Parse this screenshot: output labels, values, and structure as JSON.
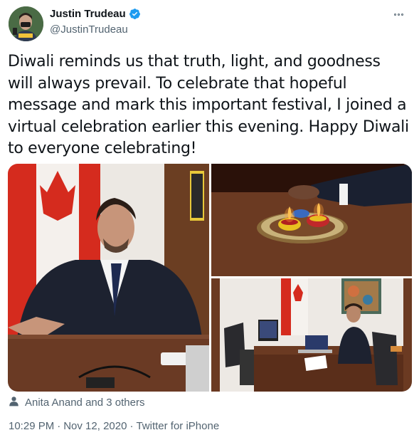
{
  "author": {
    "name": "Justin Trudeau",
    "handle": "@JustinTrudeau",
    "verified": true,
    "avatar_icon": "avatar-photo"
  },
  "tweet": {
    "text": "Diwali reminds us that truth, light, and goodness will always prevail. To celebrate that hopeful message and mark this important festival, I joined a virtual celebration earlier this evening. Happy Diwali to everyone celebrating!"
  },
  "media": [
    {
      "name": "photo-trudeau-at-desk"
    },
    {
      "name": "photo-diwali-lamps"
    },
    {
      "name": "photo-video-call-office"
    }
  ],
  "social": {
    "likes_text": "Anita Anand and 3 others",
    "icon": "person-icon"
  },
  "meta": {
    "time": "10:29 PM",
    "sep1": "·",
    "date": "Nov 12, 2020",
    "sep2": "·",
    "source": "Twitter for iPhone"
  },
  "colors": {
    "text": "#0f1419",
    "secondary": "#536471",
    "verified": "#1d9bf0"
  }
}
